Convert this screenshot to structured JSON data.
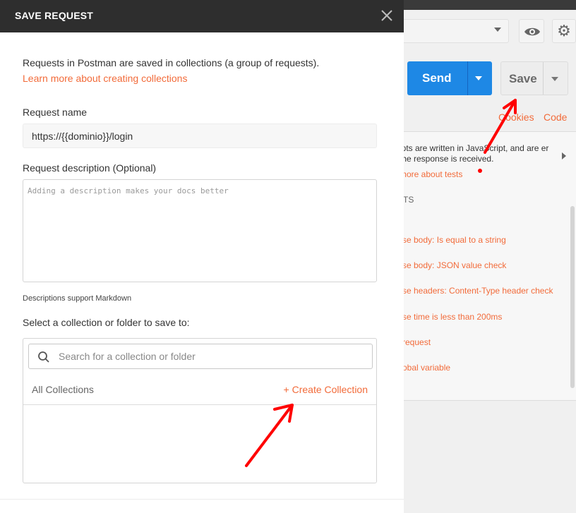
{
  "modal": {
    "title": "SAVE REQUEST",
    "intro": "Requests in Postman are saved in collections (a group of requests).",
    "learn_link": "Learn more about creating collections",
    "request_name_label": "Request name",
    "request_name_value": "https://{{dominio}}/login",
    "description_label": "Request description (Optional)",
    "description_placeholder": "Adding a description makes your docs better",
    "markdown_note": "Descriptions support Markdown",
    "select_label": "Select a collection or folder to save to:",
    "search_placeholder": "Search for a collection or folder",
    "all_collections": "All Collections",
    "create_collection": "+ Create Collection"
  },
  "background": {
    "send_label": "Send",
    "save_label": "Save",
    "cookies_link": "Cookies",
    "code_link": "Code",
    "tests_desc": "ipts are written in JavaScript, and are er the response is received.",
    "tests_learn": "more about tests",
    "snippets_head": "TS",
    "snippets": [
      "se body: Is equal to a string",
      "se body: JSON value check",
      "se headers: Content-Type header check",
      "se time is less than 200ms",
      "request",
      "obal variable"
    ]
  },
  "colors": {
    "accent": "#f26b3a",
    "send_blue": "#1e88e5",
    "header_dark": "#2e2e2e",
    "annotation_red": "#ff0000"
  },
  "icons": {
    "close": "close-icon",
    "search": "search-icon",
    "eye": "eye-icon",
    "gear": "gear-icon"
  }
}
